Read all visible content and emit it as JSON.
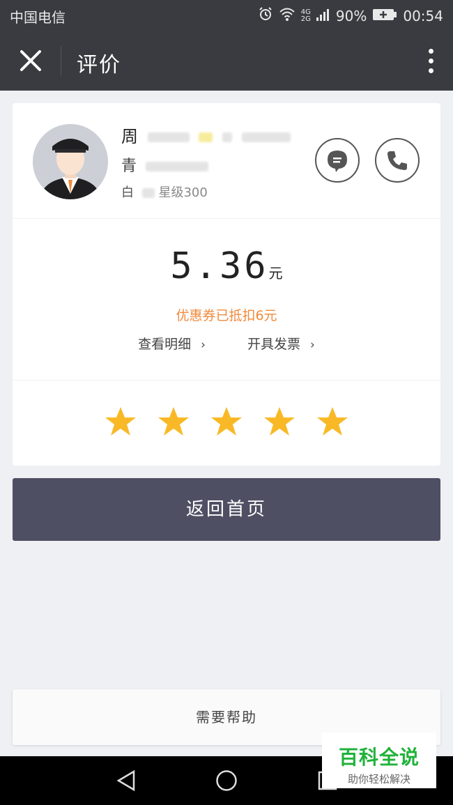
{
  "status_bar": {
    "carrier": "中国电信",
    "network_top": "4G",
    "network_bottom": "2G",
    "battery": "90%",
    "time": "00:54"
  },
  "nav": {
    "title": "评价"
  },
  "driver": {
    "name_visible": "周",
    "car_visible": "青",
    "level_visible": "白",
    "level_suffix": "星级300"
  },
  "fare": {
    "amount": "5.36",
    "unit": "元",
    "coupon_note": "优惠券已抵扣6元",
    "details_link": "查看明细",
    "invoice_link": "开具发票"
  },
  "rating": {
    "stars": 5,
    "star_color": "#f9b926"
  },
  "actions": {
    "home_button": "返回首页",
    "help_button": "需要帮助"
  },
  "watermark": {
    "title": "百科全说",
    "subtitle": "助你轻松解决"
  }
}
